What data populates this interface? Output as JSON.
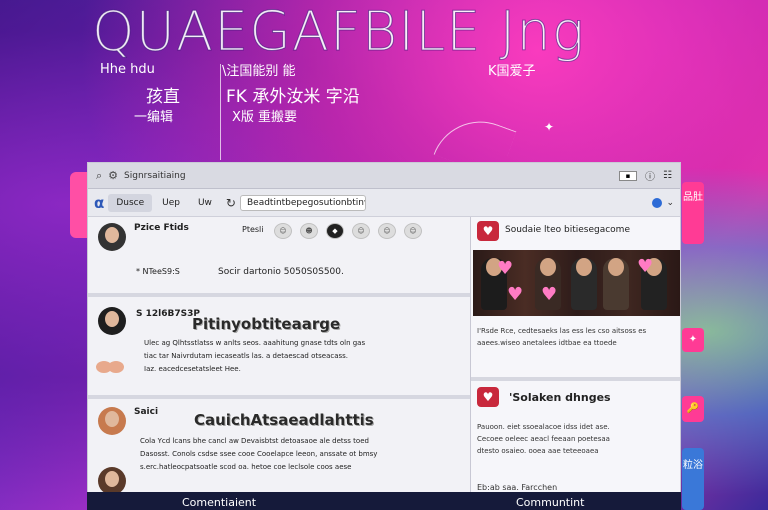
{
  "banner": {
    "title": "QUAEGAFBILE Jng",
    "sub_left_1": "Hhe hdu",
    "sub_left_2": "孩直",
    "sub_left_3": "一编辑",
    "sub_mid_1": "\\注国能别 能",
    "sub_mid_2": "FK 承外汝米 字沿",
    "sub_mid_3": "X版 重搬要",
    "sub_right": "K国爱子"
  },
  "browser": {
    "url_text": "Signrsaitiaing",
    "right_box": "▪",
    "right_info": "ⓘ",
    "right_grid": "☷"
  },
  "nav": {
    "logo": "α",
    "tabs": [
      {
        "label": "Dusce"
      },
      {
        "label": "Uep"
      },
      {
        "label": "Uw"
      }
    ],
    "search_text": "Beadtintbepegosutionbtinw"
  },
  "feed": {
    "post1_name": "Pzice Ftids",
    "post1_reaction_label": "Ptesli",
    "post1_handle": "* NTeeS9:S",
    "post1_text": "Socir dartonio 5050S0S500.",
    "post2_name": "S 12l6B7S3P",
    "post2_title": "Pitinyobtiteaarge",
    "post2_line1": "Ulec ag Qlhtsstlatss w anlts seos. aaahitung gnase tdts oln gas",
    "post2_line2": "tiac tar Naivrdutam iecaseatls las. a detaescad otseacass.",
    "post2_line3": "Iaz. eacedcesetatsleet Hee.",
    "post3_name": "Saici",
    "post3_title": "CauichAtsaeadlahttis",
    "post3_line1": "Cola Ycd lcans bhe cancl aw Devaisbtst detoasaoe ale detss toed",
    "post3_line2": "Dasosst. Conols csdse ssee cooe Cooelapce leeon, anssate ot bmsy",
    "post3_line3": "s.erc.hatleocpatsoatle scod oa. hetoe coe leclsole coos aese"
  },
  "right_panel": {
    "card1_title": "Soudaie lteo bitiesegacome",
    "card1_line1": "I'Rsde Rce, cedtesaeks las ess les cso aitsoss es",
    "card1_line2": "aaees.wiseo anetalees idtbae ea ttoede",
    "card1_line3": "",
    "card2_title": "'Solaken dhnges",
    "card2_line1": "Pauoon. eiet ssoealacoe idss idet ase.",
    "card2_line2": "Cecoee oeleec aeacl feeaan poetesaa",
    "card2_line3": "dtesto osaieo. ooea aae teteeoaea",
    "card2_footer": "Eb:ab saa. Farcchen"
  },
  "footer": {
    "left_label": "Comentiaient",
    "right_label": "Communtint"
  },
  "rail": {
    "top": "品肚",
    "mid1": "✦",
    "mid2": "🔑",
    "bottom": "粒浴"
  },
  "colors": {
    "accent_pink": "#ff4fa5",
    "heart_red": "#c8283c",
    "link_blue": "#2d58b8"
  }
}
